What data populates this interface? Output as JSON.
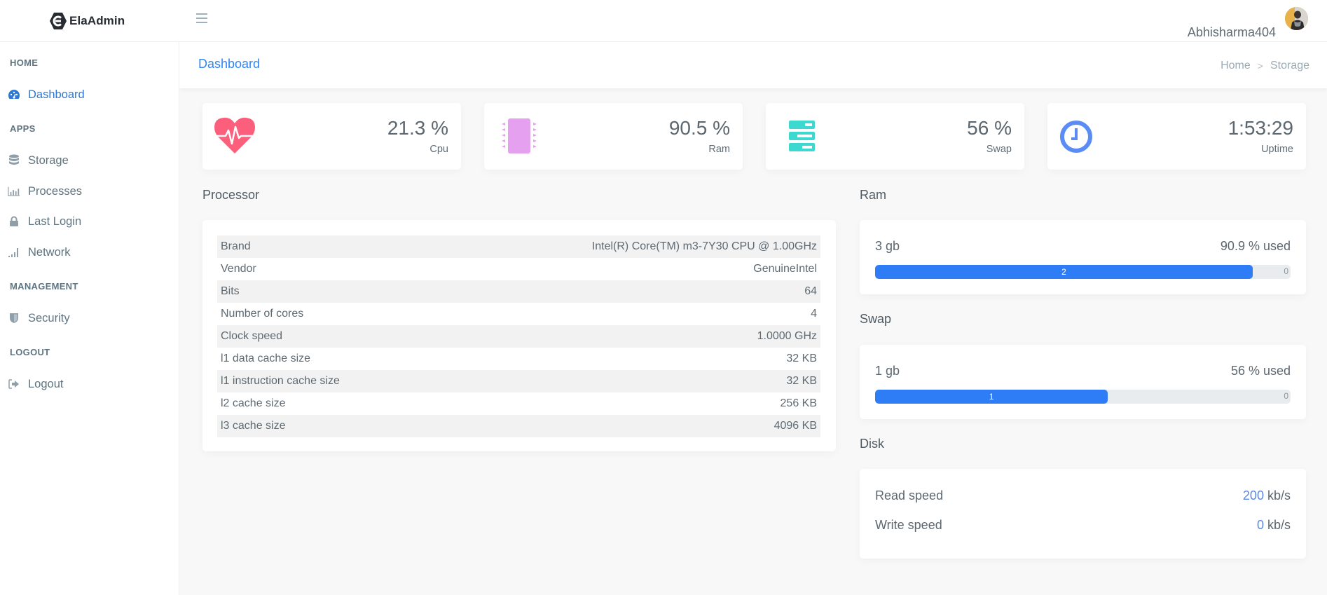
{
  "app": {
    "name": "ElaAdmin",
    "user_name": "Abhisharma404"
  },
  "sidebar": {
    "sections": [
      {
        "title": "HOME",
        "items": [
          {
            "label": "Dashboard",
            "icon": "dashboard-icon",
            "active": true
          }
        ]
      },
      {
        "title": "APPS",
        "items": [
          {
            "label": "Storage",
            "icon": "database-icon"
          },
          {
            "label": "Processes",
            "icon": "bar-chart-icon"
          },
          {
            "label": "Last Login",
            "icon": "lock-icon"
          },
          {
            "label": "Network",
            "icon": "signal-icon"
          }
        ]
      },
      {
        "title": "MANAGEMENT",
        "items": [
          {
            "label": "Security",
            "icon": "shield-icon"
          }
        ]
      },
      {
        "title": "LOGOUT",
        "items": [
          {
            "label": "Logout",
            "icon": "sign-out-icon"
          }
        ]
      }
    ]
  },
  "page": {
    "title": "Dashboard",
    "breadcrumb": [
      "Home",
      "Storage"
    ],
    "breadcrumb_separator": ">"
  },
  "stats": [
    {
      "value": "21.3 %",
      "label": "Cpu",
      "icon": "heartbeat-icon",
      "color": "#fb5f7b"
    },
    {
      "value": "90.5 %",
      "label": "Ram",
      "icon": "chip-icon",
      "color": "#e5a1ef"
    },
    {
      "value": "56 %",
      "label": "Swap",
      "icon": "server-icon",
      "color": "#3dd9d0"
    },
    {
      "value": "1:53:29",
      "label": "Uptime",
      "icon": "clock-icon",
      "color": "#5b8cf6"
    }
  ],
  "processor": {
    "title": "Processor",
    "rows": [
      {
        "label": "Brand",
        "value": "Intel(R) Core(TM) m3-7Y30 CPU @ 1.00GHz"
      },
      {
        "label": "Vendor",
        "value": "GenuineIntel"
      },
      {
        "label": "Bits",
        "value": "64"
      },
      {
        "label": "Number of cores",
        "value": "4"
      },
      {
        "label": "Clock speed",
        "value": "1.0000 GHz"
      },
      {
        "label": "l1 data cache size",
        "value": "32 KB"
      },
      {
        "label": "l1 instruction cache size",
        "value": "32 KB"
      },
      {
        "label": "l2 cache size",
        "value": "256 KB"
      },
      {
        "label": "l3 cache size",
        "value": "4096 KB"
      }
    ]
  },
  "ram": {
    "title": "Ram",
    "total": "3 gb",
    "used_text": "90.9 % used",
    "used_fraction": 0.909,
    "bar_used_label": "2",
    "bar_free_label": "0"
  },
  "swap": {
    "title": "Swap",
    "total": "1 gb",
    "used_text": "56 % used",
    "used_fraction": 0.56,
    "bar_used_label": "1",
    "bar_free_label": "0"
  },
  "disk": {
    "title": "Disk",
    "read_label": "Read speed",
    "read_value": "200",
    "write_label": "Write speed",
    "write_value": "0",
    "unit": "kb/s"
  },
  "colors": {
    "accent": "#2f86f6",
    "progress": "#2e7cf6"
  }
}
